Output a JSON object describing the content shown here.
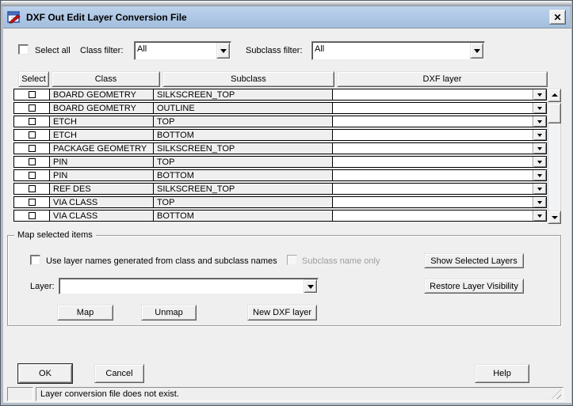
{
  "window": {
    "title": "DXF Out Edit Layer Conversion File",
    "close_glyph": "✕"
  },
  "colors": {
    "titlebar_top": "#bdd2ec",
    "titlebar_bottom": "#a2bedd",
    "client_bg": "#efefef"
  },
  "filters": {
    "select_all_label": "Select all",
    "class_filter_label": "Class filter:",
    "class_filter_value": "All",
    "subclass_filter_label": "Subclass filter:",
    "subclass_filter_value": "All"
  },
  "table": {
    "headers": [
      "Select",
      "Class",
      "Subclass",
      "DXF layer"
    ],
    "rows": [
      {
        "class": "BOARD GEOMETRY",
        "subclass": "SILKSCREEN_TOP",
        "dxf_layer": ""
      },
      {
        "class": "BOARD GEOMETRY",
        "subclass": "OUTLINE",
        "dxf_layer": ""
      },
      {
        "class": "ETCH",
        "subclass": "TOP",
        "dxf_layer": ""
      },
      {
        "class": "ETCH",
        "subclass": "BOTTOM",
        "dxf_layer": ""
      },
      {
        "class": "PACKAGE GEOMETRY",
        "subclass": "SILKSCREEN_TOP",
        "dxf_layer": ""
      },
      {
        "class": "PIN",
        "subclass": "TOP",
        "dxf_layer": ""
      },
      {
        "class": "PIN",
        "subclass": "BOTTOM",
        "dxf_layer": ""
      },
      {
        "class": "REF DES",
        "subclass": "SILKSCREEN_TOP",
        "dxf_layer": ""
      },
      {
        "class": "VIA CLASS",
        "subclass": "TOP",
        "dxf_layer": ""
      },
      {
        "class": "VIA CLASS",
        "subclass": "BOTTOM",
        "dxf_layer": ""
      }
    ]
  },
  "map_group": {
    "title": "Map selected items",
    "use_layer_names_label": "Use layer names generated from class and subclass names",
    "subclass_name_only_label": "Subclass name only",
    "show_selected_layers_label": "Show Selected Layers",
    "restore_layer_visibility_label": "Restore Layer Visibility",
    "layer_label": "Layer:",
    "layer_value": "",
    "map_label": "Map",
    "unmap_label": "Unmap",
    "new_dxf_layer_label": "New DXF layer"
  },
  "footer": {
    "ok_label": "OK",
    "cancel_label": "Cancel",
    "help_label": "Help"
  },
  "status_bar": {
    "message": "Layer conversion file does not exist."
  }
}
